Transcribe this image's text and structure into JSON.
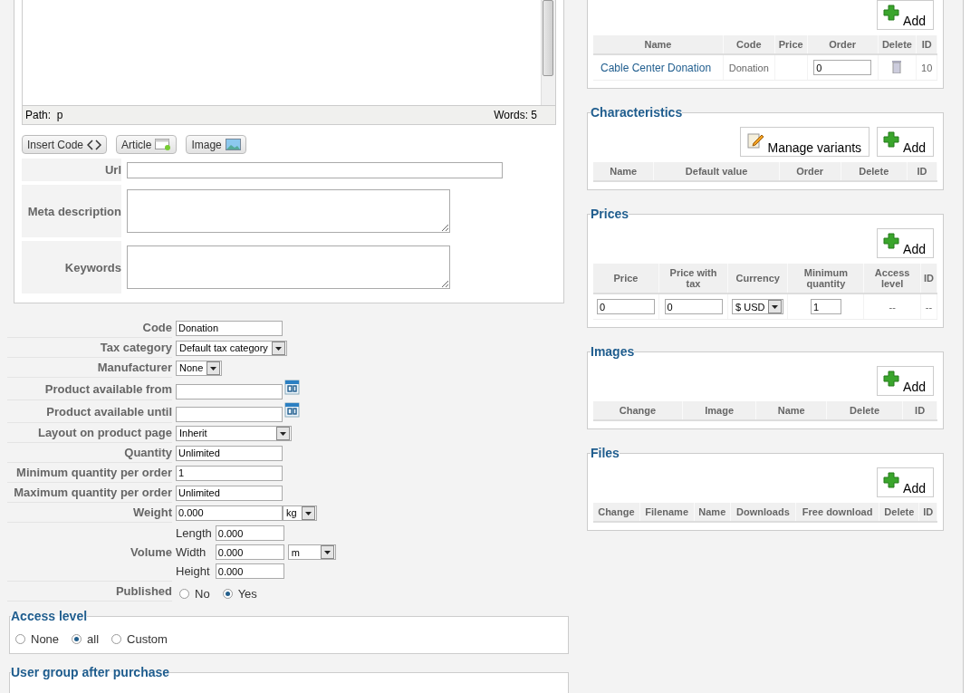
{
  "editor": {
    "path_label": "Path:",
    "path": "p",
    "word_count": "Words: 5"
  },
  "editor_buttons": [
    {
      "kind": "code",
      "label": "Insert Code"
    },
    {
      "kind": "article",
      "label": "Article"
    },
    {
      "kind": "image",
      "label": "Image"
    }
  ],
  "meta_fields": [
    {
      "kind": "line",
      "label": "Url"
    },
    {
      "kind": "area",
      "label": "Meta description"
    },
    {
      "kind": "area",
      "label": "Keywords"
    }
  ],
  "params": [
    {
      "kind": "text",
      "label": "Code",
      "value": "Donation"
    },
    {
      "kind": "select",
      "label": "Tax category",
      "value": "Default tax category"
    },
    {
      "kind": "select",
      "label": "Manufacturer",
      "value": "None"
    },
    {
      "kind": "date",
      "label": "Product available from"
    },
    {
      "kind": "date",
      "label": "Product available until"
    },
    {
      "kind": "select",
      "label": "Layout on product page",
      "value": "Inherit"
    },
    {
      "kind": "text",
      "label": "Quantity",
      "value": "Unlimited"
    },
    {
      "kind": "text",
      "label": "Minimum quantity per order",
      "value": "1"
    },
    {
      "kind": "text",
      "label": "Maximum quantity per order",
      "value": "Unlimited"
    },
    {
      "kind": "unit",
      "label": "Weight",
      "value": "0.000",
      "unit": "kg"
    },
    {
      "kind": "volume",
      "label": "Volume",
      "unit": "m",
      "dims": [
        {
          "label": "Length",
          "value": "0.000"
        },
        {
          "label": "Width",
          "value": "0.000"
        },
        {
          "label": "Height",
          "value": "0.000"
        }
      ]
    },
    {
      "kind": "radio",
      "label": "Published",
      "options": [
        {
          "label": "No",
          "selected": false
        },
        {
          "label": "Yes",
          "selected": true
        }
      ]
    }
  ],
  "access_level": {
    "title": "Access level",
    "options": [
      {
        "label": "None",
        "selected": false
      },
      {
        "label": "all",
        "selected": true
      },
      {
        "label": "Custom",
        "selected": false
      }
    ]
  },
  "user_group": {
    "title": "User group after purchase"
  },
  "panels": [
    {
      "buttons": [
        {
          "kind": "add",
          "label": "Add"
        }
      ],
      "columns": [
        "Name",
        "Code",
        "Price",
        "Order",
        "Delete",
        "ID"
      ],
      "rows": [
        [
          {
            "kind": "link",
            "value": "Cable Center Donation"
          },
          {
            "kind": "text",
            "value": "Donation"
          },
          {
            "kind": "blank"
          },
          {
            "kind": "input",
            "value": "0"
          },
          {
            "kind": "delete"
          },
          {
            "kind": "text",
            "value": "10"
          }
        ]
      ]
    },
    {
      "title": "Characteristics",
      "buttons": [
        {
          "kind": "variants",
          "label": "Manage variants"
        },
        {
          "kind": "add",
          "label": "Add"
        }
      ],
      "columns": [
        "Name",
        "Default value",
        "Order",
        "Delete",
        "ID"
      ]
    },
    {
      "title": "Prices",
      "buttons": [
        {
          "kind": "add",
          "label": "Add"
        }
      ],
      "columns": [
        "Price",
        "Price with tax",
        "Currency",
        "Minimum quantity",
        "Access level",
        "ID"
      ],
      "rows": [
        [
          {
            "kind": "input",
            "value": "0"
          },
          {
            "kind": "input",
            "value": "0"
          },
          {
            "kind": "select",
            "value": "$ USD"
          },
          {
            "kind": "input",
            "value": "1"
          },
          {
            "kind": "text",
            "value": "--"
          },
          {
            "kind": "text",
            "value": "--"
          }
        ]
      ]
    },
    {
      "title": "Images",
      "buttons": [
        {
          "kind": "add",
          "label": "Add"
        }
      ],
      "columns": [
        "Change",
        "Image",
        "Name",
        "Delete",
        "ID"
      ]
    },
    {
      "title": "Files",
      "buttons": [
        {
          "kind": "add",
          "label": "Add"
        }
      ],
      "columns": [
        "Change",
        "Filename",
        "Name",
        "Downloads",
        "Free download",
        "Delete",
        "ID"
      ]
    }
  ]
}
